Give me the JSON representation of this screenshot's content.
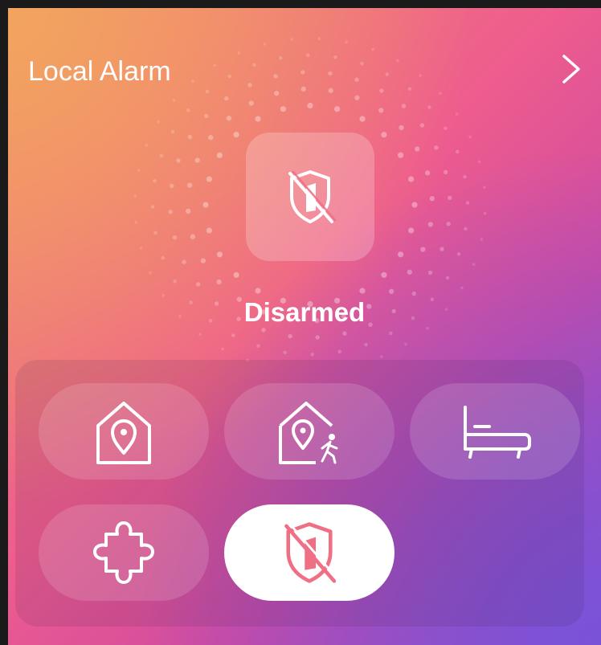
{
  "header": {
    "title": "Local Alarm"
  },
  "status": {
    "label": "Disarmed"
  },
  "modes": [
    {
      "name": "home-mode",
      "icon": "house-pin-icon",
      "active": false
    },
    {
      "name": "away-mode",
      "icon": "house-pin-walking-icon",
      "active": false
    },
    {
      "name": "sleep-mode",
      "icon": "bed-icon",
      "active": false
    },
    {
      "name": "custom-mode",
      "icon": "puzzle-icon",
      "active": false
    },
    {
      "name": "disarm-mode",
      "icon": "shield-disarmed-icon",
      "active": true
    }
  ],
  "colors": {
    "accent": "#ef6f84",
    "text": "#ffffff"
  }
}
